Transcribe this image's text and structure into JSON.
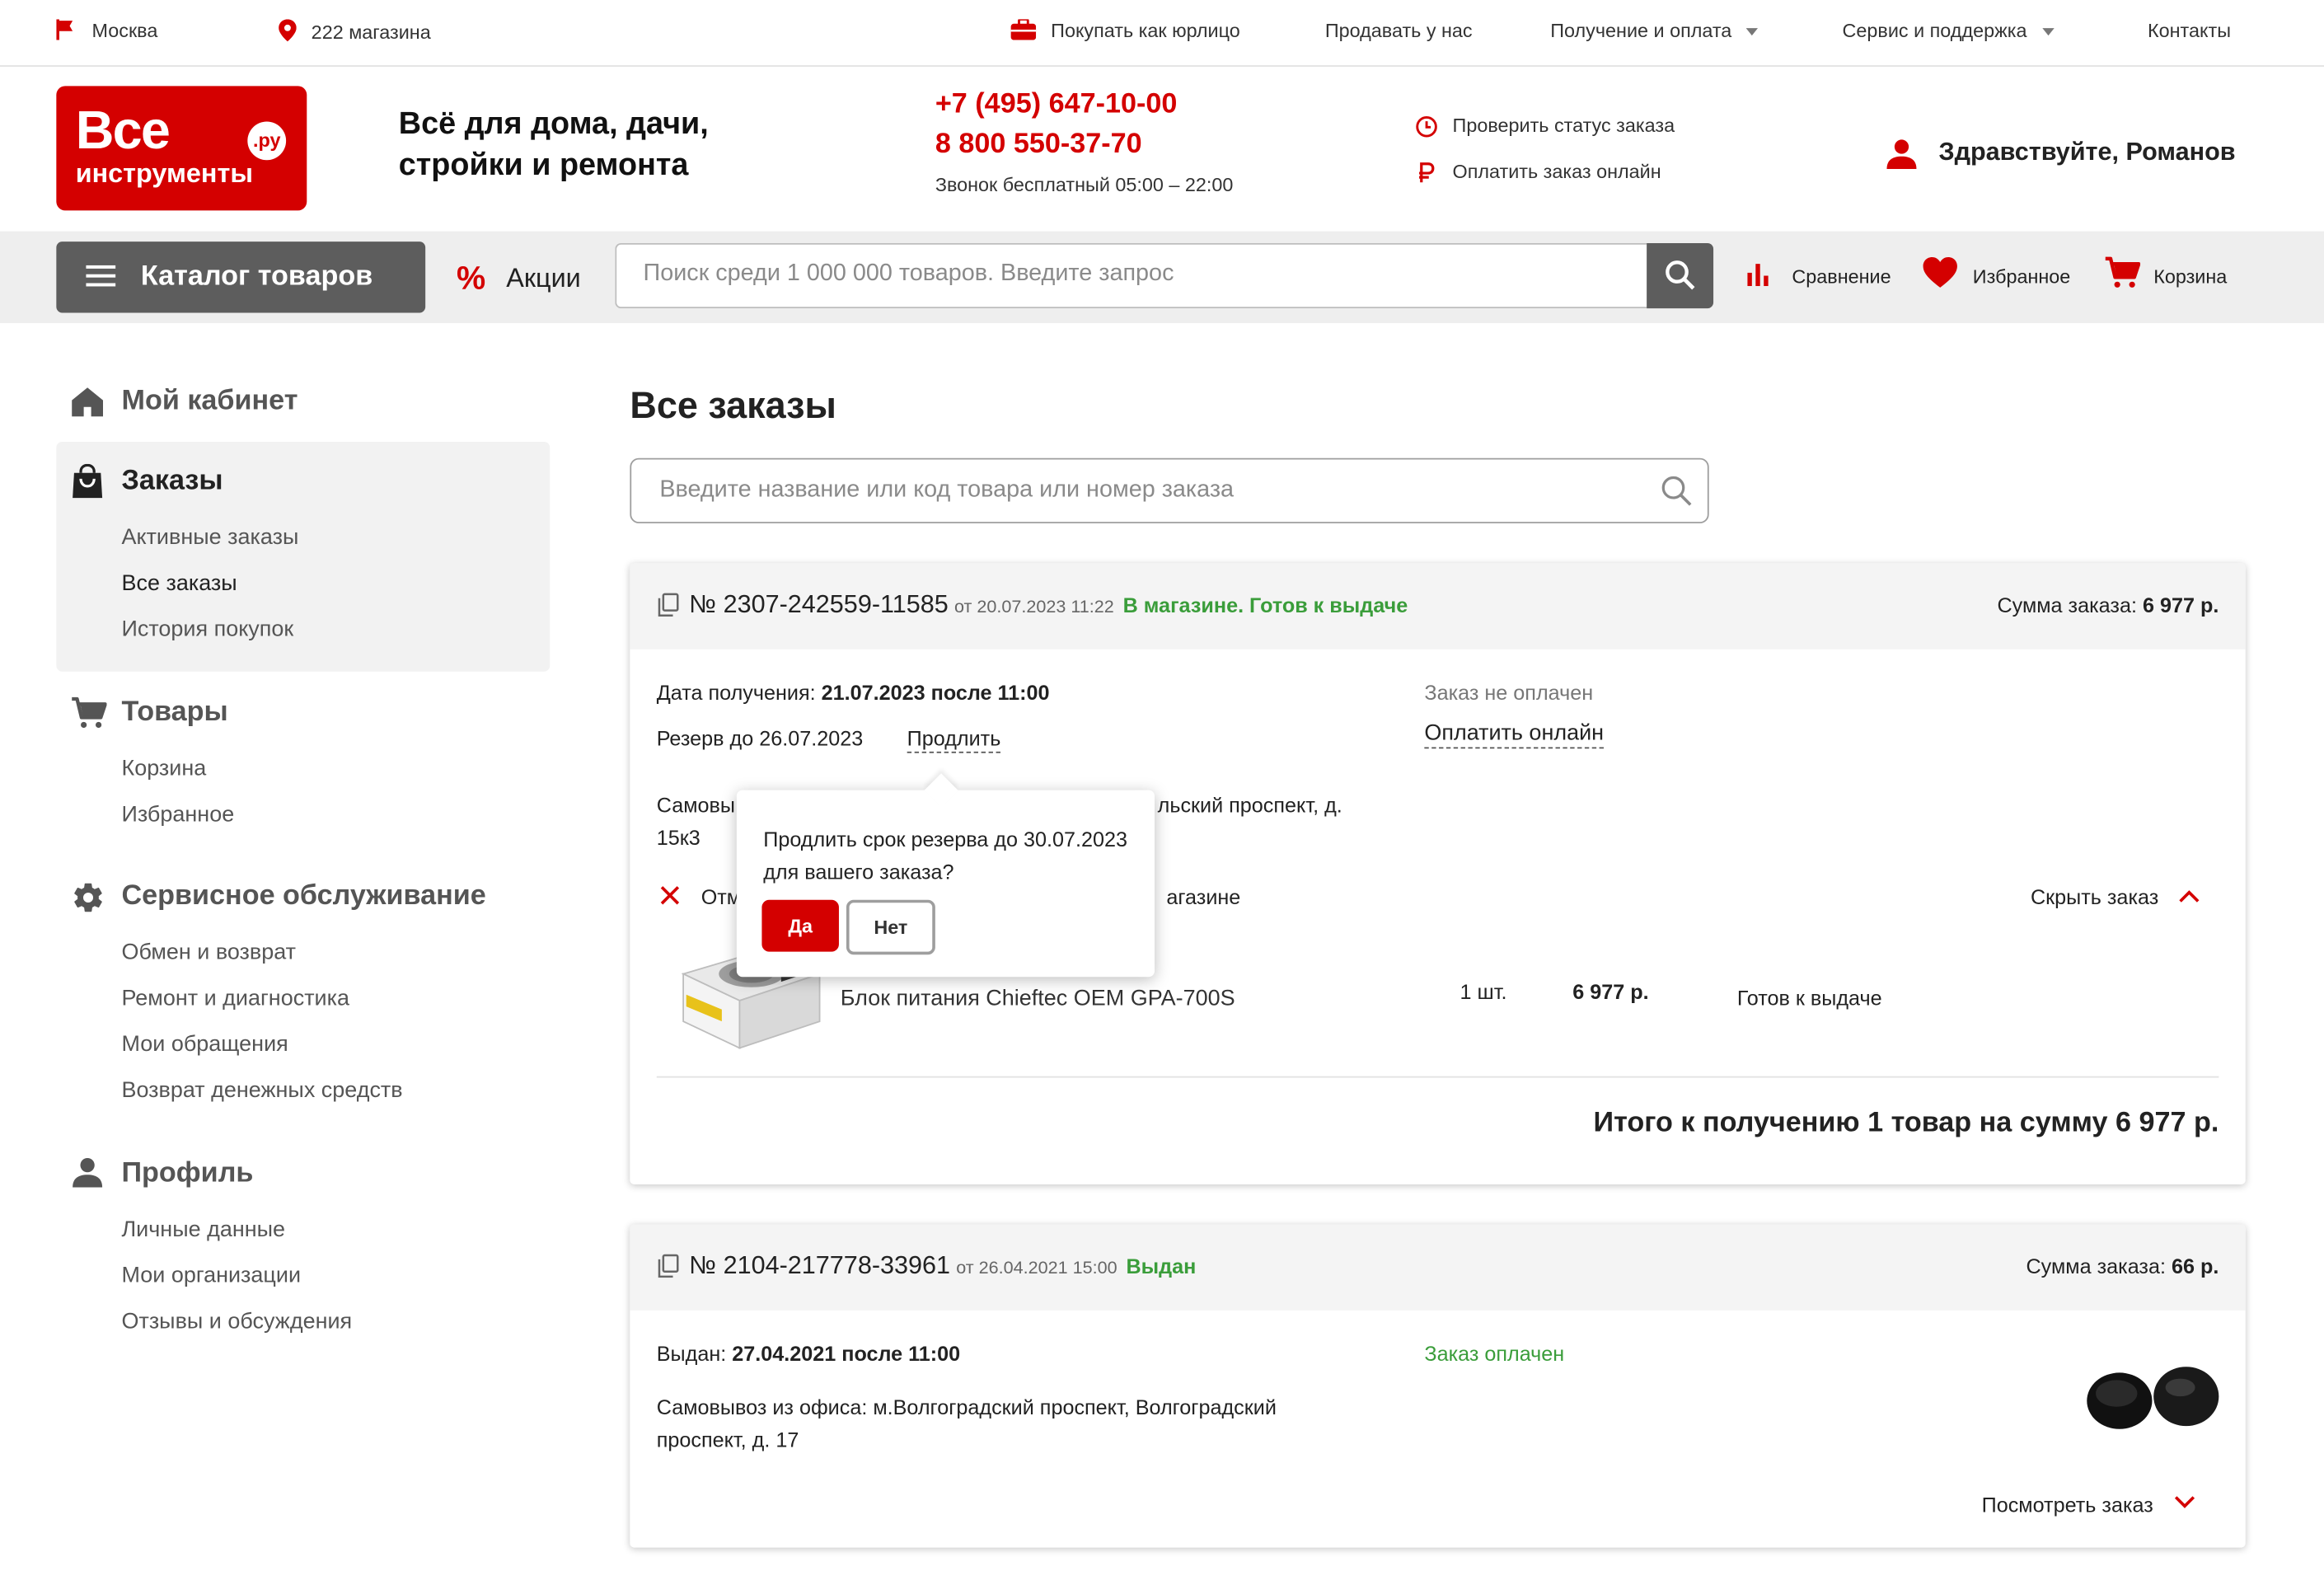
{
  "topbar": {
    "city": "Москва",
    "stores": "222 магазина",
    "links": [
      "Покупать как юрлицо",
      "Продавать у нас",
      "Получение и оплата",
      "Сервис и поддержка",
      "Контакты"
    ]
  },
  "header": {
    "logo_line1": "Все",
    "logo_line2": "инструменты",
    "logo_ru": ".ру",
    "tagline_line1": "Всё для дома, дачи,",
    "tagline_line2": "стройки и ремонта",
    "phone1": "+7 (495) 647-10-00",
    "phone2": "8 800 550-37-70",
    "hours": "Звонок бесплатный 05:00 – 22:00",
    "check_status": "Проверить статус заказа",
    "pay_online": "Оплатить заказ онлайн",
    "greeting": "Здравствуйте, Романов"
  },
  "navbar": {
    "catalog": "Каталог товаров",
    "promo": "Акции",
    "search_placeholder": "Поиск среди 1 000 000 товаров. Введите запрос",
    "compare": "Сравнение",
    "favorites": "Избранное",
    "cart": "Корзина"
  },
  "sidebar": {
    "cabinet": "Мой кабинет",
    "orders": "Заказы",
    "orders_links": [
      "Активные заказы",
      "Все заказы",
      "История покупок"
    ],
    "goods": "Товары",
    "goods_links": [
      "Корзина",
      "Избранное"
    ],
    "service": "Сервисное обслуживание",
    "service_links": [
      "Обмен и возврат",
      "Ремонт и диагностика",
      "Мои обращения",
      "Возврат денежных средств"
    ],
    "profile": "Профиль",
    "profile_links": [
      "Личные данные",
      "Мои организации",
      "Отзывы и обсуждения"
    ]
  },
  "main": {
    "title": "Все заказы",
    "search_placeholder": "Введите название или код товара или номер заказа"
  },
  "orders": [
    {
      "number": "№ 2307-242559-11585",
      "date": "от 20.07.2023 11:22",
      "status": "В магазине. Готов к выдаче",
      "sum_label": "Сумма заказа:",
      "sum": "6 977 р.",
      "receive_label": "Дата получения:",
      "receive_value": "21.07.2023 после 11:00",
      "reserve": "Резерв до 26.07.2023",
      "extend": "Продлить",
      "payment_status": "Заказ не оплачен",
      "pay_link": "Оплатить онлайн",
      "pickup_left": "Самовы",
      "pickup_right": "льский проспект, д.",
      "pickup_line2": "15к3",
      "cancel_left": "Отм",
      "cancel_right": "агазине",
      "hide": "Скрыть заказ",
      "item_name": "Блок питания Chieftec OEM GPA-700S",
      "item_qty": "1 шт.",
      "item_price": "6 977 р.",
      "item_status": "Готов к выдаче",
      "total": "Итого к получению 1 товар на сумму 6 977 р."
    },
    {
      "number": "№ 2104-217778-33961",
      "date": "от 26.04.2021 15:00",
      "status": "Выдан",
      "sum_label": "Сумма заказа:",
      "sum": "66 р.",
      "issued_label": "Выдан:",
      "issued_value": "27.04.2021 после 11:00",
      "payment_status": "Заказ оплачен",
      "pickup_line1": "Самовывоз из офиса: м.Волгоградский проспект, Волгоградский",
      "pickup_line2": "проспект, д. 17",
      "view": "Посмотреть заказ"
    }
  ],
  "popover": {
    "text": "Продлить срок резерва до 30.07.2023 для вашего заказа?",
    "yes": "Да",
    "no": "Нет"
  },
  "colors": {
    "brand": "#d40000",
    "success": "#3a9d3a",
    "dark_gray": "#5d5d5d"
  }
}
